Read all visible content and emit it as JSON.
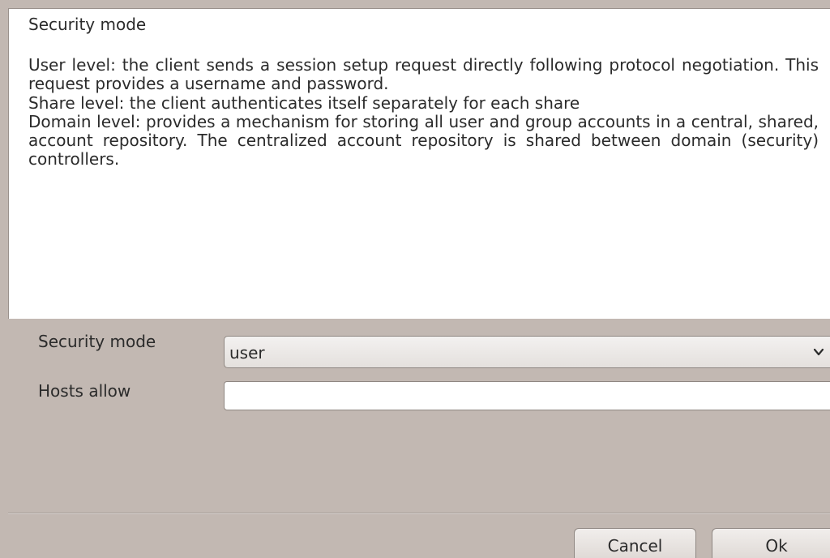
{
  "help": {
    "title": "Security mode",
    "lines": [
      "User level: the client sends a session setup request directly following protocol negotiation. This request provides a username and password.",
      "Share level: the client authenticates itself separately for each share",
      "Domain level: provides a mechanism for storing all user and group accounts in a central, shared, account repository. The centralized account repository is shared between domain (security) controllers."
    ]
  },
  "form": {
    "security_mode": {
      "label": "Security mode",
      "value": "user",
      "icon": "chevron-down-icon"
    },
    "hosts_allow": {
      "label": "Hosts allow",
      "value": "",
      "placeholder": ""
    }
  },
  "buttons": {
    "cancel": "Cancel",
    "ok": "Ok"
  },
  "colors": {
    "dialog_background": "#c2b8b2",
    "panel_background": "#ffffff",
    "text": "#2b2b2b"
  }
}
